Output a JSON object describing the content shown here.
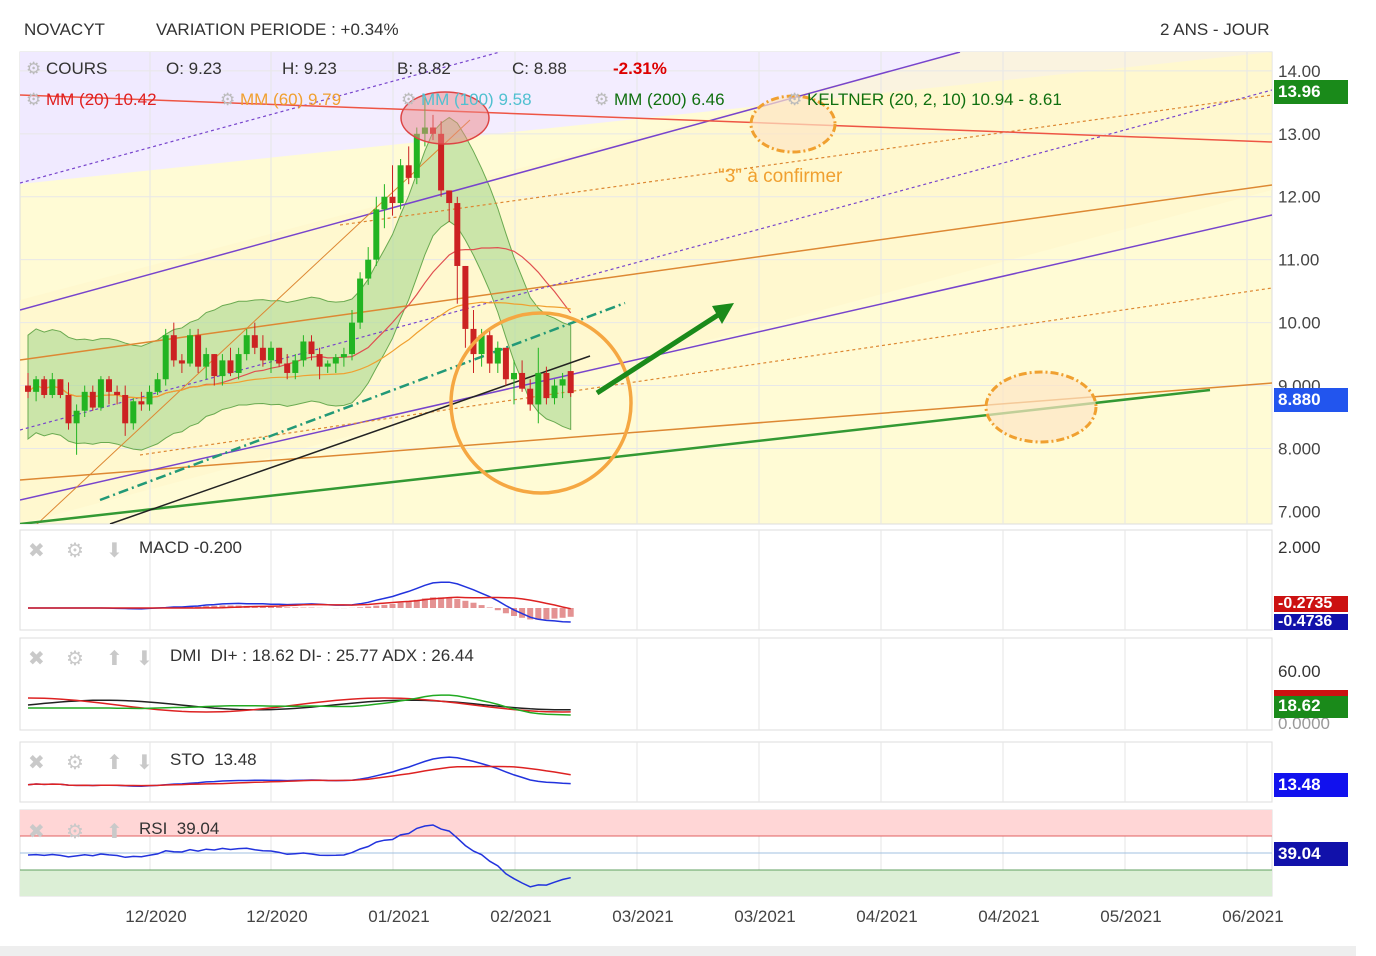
{
  "header": {
    "ticker": "NOVACYT",
    "variation": "VARIATION PERIODE : +0.34%",
    "period": "2 ANS - JOUR"
  },
  "legend": {
    "cours": "COURS",
    "open": "O: 9.23",
    "high": "H: 9.23",
    "low": "B: 8.82",
    "close": "C: 8.88",
    "change": "-2.31%",
    "mm20": "MM (20) 10.42",
    "mm60": "MM (60) 9.79",
    "mm100": "MM (100) 9.58",
    "mm200": "MM (200) 6.46",
    "keltner": "KELTNER (20, 2, 10) 10.94 - 8.61"
  },
  "annotation": "\"3\" à confirmer",
  "colors": {
    "up": "#22b422",
    "down": "#cc2222",
    "mm20": "#e05050",
    "mm60": "#f0a030",
    "mm100": "#50c8d0",
    "mm200": "#1a8a1a",
    "keltner_fill": "#a8d890",
    "bg": "#fffbd5",
    "purple_zone": "#f2ecff",
    "blue_tag": "#2255ee",
    "green_tag": "#1a8a1a",
    "red_tag": "#cc1111",
    "navy_tag": "#1111aa"
  },
  "price_axis": [
    "13.00",
    "12.00",
    "11.00",
    "10.00",
    "8.000",
    "7.000"
  ],
  "price_axis_hidden": [
    "14.00",
    "9.000"
  ],
  "price_tags": {
    "top": "13.96",
    "current": "8.880"
  },
  "x_axis": [
    "12/2020",
    "12/2020",
    "01/2021",
    "02/2021",
    "03/2021",
    "03/2021",
    "04/2021",
    "04/2021",
    "05/2021",
    "06/2021"
  ],
  "macd": {
    "label": "MACD",
    "value": "-0.200",
    "axis": "2.000",
    "tag1": "-0.2735",
    "tag2": "-0.4736"
  },
  "dmi": {
    "label": "DMI",
    "value": "DI+ : 18.62 DI- : 25.77 ADX : 26.44",
    "axis_top": "60.00",
    "axis_bottom": "0.0000",
    "tag": "18.62"
  },
  "sto": {
    "label": "STO",
    "value": "13.48",
    "tag": "13.48"
  },
  "rsi": {
    "label": "RSI",
    "value": "39.04",
    "tag": "39.04"
  },
  "chart_data": {
    "type": "candlestick",
    "ylim": [
      6.8,
      14.3
    ],
    "candles": [
      [
        9.0,
        9.2,
        8.8,
        8.9
      ],
      [
        8.9,
        9.15,
        8.75,
        9.1
      ],
      [
        9.1,
        9.15,
        8.8,
        8.85
      ],
      [
        8.85,
        9.2,
        8.8,
        9.1
      ],
      [
        9.1,
        9.1,
        8.8,
        8.85
      ],
      [
        8.85,
        9.05,
        8.3,
        8.4
      ],
      [
        8.4,
        8.7,
        7.9,
        8.6
      ],
      [
        8.6,
        9.0,
        8.5,
        8.9
      ],
      [
        8.9,
        9.0,
        8.6,
        8.65
      ],
      [
        8.65,
        9.15,
        8.6,
        9.1
      ],
      [
        9.1,
        9.15,
        8.7,
        8.9
      ],
      [
        8.9,
        9.0,
        8.7,
        8.85
      ],
      [
        8.85,
        9.0,
        8.2,
        8.4
      ],
      [
        8.4,
        8.8,
        8.3,
        8.75
      ],
      [
        8.75,
        8.9,
        8.6,
        8.7
      ],
      [
        8.7,
        9.0,
        8.6,
        8.9
      ],
      [
        8.9,
        9.2,
        8.85,
        9.1
      ],
      [
        9.1,
        9.9,
        9.0,
        9.8
      ],
      [
        9.8,
        10.0,
        9.3,
        9.4
      ],
      [
        9.4,
        9.5,
        9.2,
        9.35
      ],
      [
        9.35,
        9.9,
        9.3,
        9.8
      ],
      [
        9.8,
        9.9,
        9.2,
        9.3
      ],
      [
        9.3,
        9.6,
        9.1,
        9.5
      ],
      [
        9.5,
        9.5,
        9.0,
        9.15
      ],
      [
        9.15,
        9.5,
        9.0,
        9.4
      ],
      [
        9.4,
        9.6,
        9.15,
        9.2
      ],
      [
        9.2,
        9.6,
        9.1,
        9.5
      ],
      [
        9.5,
        9.9,
        9.4,
        9.8
      ],
      [
        9.8,
        10.0,
        9.5,
        9.6
      ],
      [
        9.6,
        9.8,
        9.3,
        9.4
      ],
      [
        9.4,
        9.7,
        9.2,
        9.6
      ],
      [
        9.6,
        9.6,
        9.3,
        9.35
      ],
      [
        9.35,
        9.5,
        9.1,
        9.2
      ],
      [
        9.2,
        9.5,
        9.1,
        9.4
      ],
      [
        9.4,
        9.8,
        9.3,
        9.7
      ],
      [
        9.7,
        9.8,
        9.4,
        9.5
      ],
      [
        9.5,
        9.6,
        9.1,
        9.3
      ],
      [
        9.3,
        9.4,
        9.2,
        9.35
      ],
      [
        9.35,
        9.5,
        9.2,
        9.45
      ],
      [
        9.45,
        9.6,
        9.3,
        9.5
      ],
      [
        9.5,
        10.2,
        9.4,
        10.0
      ],
      [
        10.0,
        10.8,
        9.9,
        10.7
      ],
      [
        10.7,
        11.2,
        10.6,
        11.0
      ],
      [
        11.0,
        12.0,
        10.9,
        11.8
      ],
      [
        11.8,
        12.2,
        11.5,
        12.0
      ],
      [
        12.0,
        12.5,
        11.7,
        11.9
      ],
      [
        11.9,
        12.6,
        11.8,
        12.5
      ],
      [
        12.5,
        12.8,
        12.2,
        12.3
      ],
      [
        12.3,
        13.1,
        12.2,
        13.0
      ],
      [
        13.0,
        13.6,
        12.8,
        13.1
      ],
      [
        13.1,
        13.3,
        12.9,
        13.0
      ],
      [
        13.0,
        13.2,
        12.0,
        12.1
      ],
      [
        12.1,
        12.1,
        11.6,
        11.9
      ],
      [
        11.9,
        12.0,
        10.3,
        10.9
      ],
      [
        10.9,
        10.9,
        9.6,
        9.9
      ],
      [
        9.9,
        10.2,
        9.2,
        9.5
      ],
      [
        9.5,
        9.9,
        9.3,
        9.8
      ],
      [
        9.8,
        9.9,
        9.2,
        9.35
      ],
      [
        9.35,
        9.7,
        9.2,
        9.6
      ],
      [
        9.6,
        9.6,
        9.0,
        9.1
      ],
      [
        9.1,
        9.4,
        8.7,
        9.2
      ],
      [
        9.2,
        9.4,
        8.9,
        8.95
      ],
      [
        8.95,
        9.1,
        8.6,
        8.7
      ],
      [
        8.7,
        9.6,
        8.4,
        9.2
      ],
      [
        9.2,
        9.3,
        8.7,
        8.8
      ],
      [
        8.8,
        9.1,
        8.7,
        9.0
      ],
      [
        9.0,
        9.2,
        8.8,
        9.1
      ],
      [
        9.23,
        9.23,
        8.82,
        8.88
      ]
    ]
  }
}
